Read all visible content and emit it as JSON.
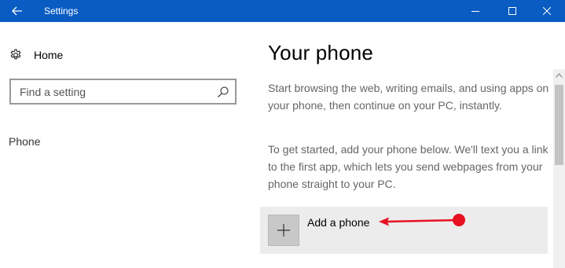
{
  "window": {
    "title": "Settings",
    "title_bar_color": "#0a5cc2"
  },
  "nav": {
    "home_label": "Home",
    "search_placeholder": "Find a setting",
    "section_label": "Phone"
  },
  "main": {
    "title": "Your phone",
    "paragraph1": "Start browsing the web, writing emails, and using apps on your phone, then continue on your PC, instantly.",
    "paragraph2": "To get started, add your phone below. We'll text you a link to the first app, which lets you send webpages from your phone straight to your PC.",
    "add_phone_label": "Add a phone"
  },
  "annotation": {
    "arrow_color": "#e81123"
  },
  "icons": {
    "back": "back-arrow-icon",
    "minimize": "minimize-icon",
    "maximize": "maximize-icon",
    "close": "close-icon",
    "home": "gear-icon",
    "search": "search-icon",
    "add": "plus-icon"
  }
}
